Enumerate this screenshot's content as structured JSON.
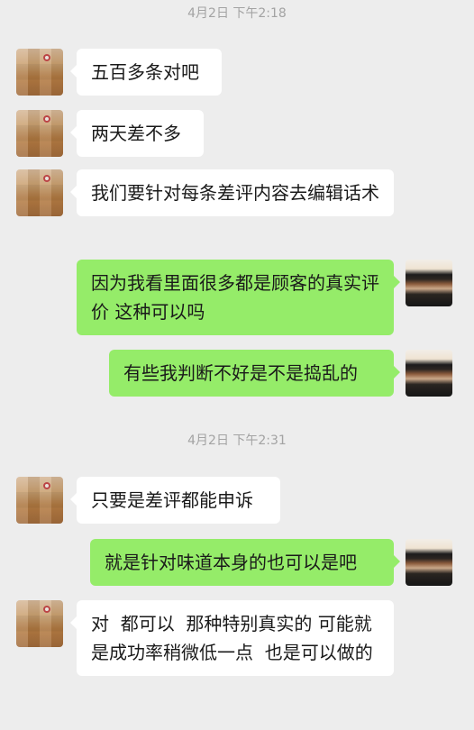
{
  "timestamps": [
    "4月2日 下午2:18",
    "4月2日 下午2:31"
  ],
  "messages": [
    {
      "side": "in",
      "text": "五百多条对吧"
    },
    {
      "side": "in",
      "text": "两天差不多"
    },
    {
      "side": "in",
      "text": "我们要针对每条差评内容去编辑话术"
    },
    {
      "side": "out",
      "text": "因为我看里面很多都是顾客的真实评价 这种可以吗"
    },
    {
      "side": "out",
      "text": "有些我判断不好是不是捣乱的"
    },
    {
      "side": "in",
      "text": "只要是差评都能申诉"
    },
    {
      "side": "out",
      "text": "就是针对味道本身的也可以是吧"
    },
    {
      "side": "in",
      "text": "对  都可以  那种特别真实的 可能就是成功率稍微低一点  也是可以做的"
    }
  ],
  "avatars": {
    "contact": "dog-avatar-icon",
    "self": "sunset-avatar-icon"
  },
  "colors": {
    "background": "#ededed",
    "incoming_bubble": "#ffffff",
    "outgoing_bubble": "#95ec69",
    "timestamp": "#a3a3a3"
  }
}
